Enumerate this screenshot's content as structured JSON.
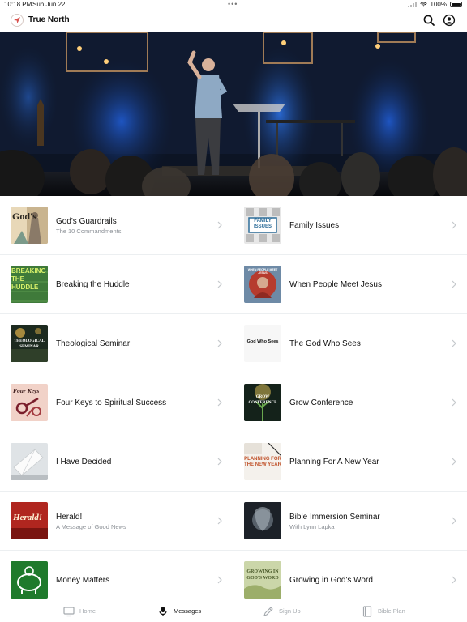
{
  "status_bar": {
    "time": "10:18 PM",
    "date": "Sun Jun 22",
    "dots": "•••",
    "battery": "100%"
  },
  "header": {
    "title": "True North"
  },
  "series": [
    {
      "title": "God's Guardrails",
      "subtitle": "The 10 Commandments",
      "thumb_text": "God's"
    },
    {
      "title": "Family Issues",
      "subtitle": "",
      "thumb_text": "FAMILY ISSUES"
    },
    {
      "title": "Breaking the Huddle",
      "subtitle": "",
      "thumb_text": "BREAKING THE HUDDLE"
    },
    {
      "title": "When People Meet Jesus",
      "subtitle": "",
      "thumb_text": "WHEN PEOPLE MEET JESUS"
    },
    {
      "title": "Theological Seminar",
      "subtitle": "",
      "thumb_text": "THEOLOGICAL SEMINAR"
    },
    {
      "title": "The God Who Sees",
      "subtitle": "",
      "thumb_text": "God Who Sees"
    },
    {
      "title": "Four Keys to Spiritual Success",
      "subtitle": "",
      "thumb_text": "Four Keys"
    },
    {
      "title": "Grow Conference",
      "subtitle": "",
      "thumb_text": "GROW CONFERENCE"
    },
    {
      "title": "I Have Decided",
      "subtitle": "",
      "thumb_text": ""
    },
    {
      "title": "Planning For A New Year",
      "subtitle": "",
      "thumb_text": "PLANNING FOR THE NEW YEAR"
    },
    {
      "title": "Herald!",
      "subtitle": "A Message of Good News",
      "thumb_text": "Herald!"
    },
    {
      "title": "Bible Immersion Seminar",
      "subtitle": "With Lynn Lapka",
      "thumb_text": ""
    },
    {
      "title": "Money Matters",
      "subtitle": "",
      "thumb_text": ""
    },
    {
      "title": "Growing in God's Word",
      "subtitle": "",
      "thumb_text": "GROWING IN GOD'S WORD"
    }
  ],
  "tabs": [
    {
      "label": "Home",
      "icon": "tv-icon",
      "active": false
    },
    {
      "label": "Messages",
      "icon": "microphone-icon",
      "active": true
    },
    {
      "label": "Sign Up",
      "icon": "pen-icon",
      "active": false
    },
    {
      "label": "Bible Plan",
      "icon": "book-icon",
      "active": false
    }
  ],
  "colors": {
    "accent": "#d9534f",
    "tab_inactive": "#a4a9ae",
    "divider": "#eceff1"
  }
}
